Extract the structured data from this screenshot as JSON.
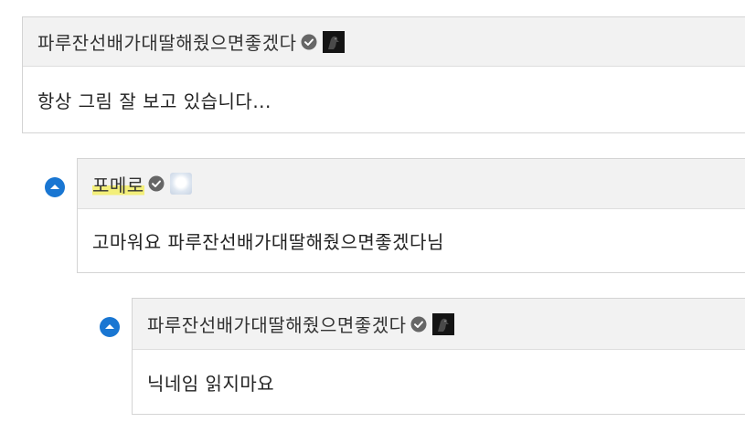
{
  "comments": [
    {
      "nickname": "파루잔선배가대딸해줬으면좋겠다",
      "avatar": "crow-avatar-icon",
      "verified": "check-circle-icon",
      "text": "항상 그림 잘 보고 있습니다..."
    },
    {
      "nickname": "포메로",
      "avatar": "character-avatar-icon",
      "verified": "check-circle-icon",
      "reply_icon": "reply-arrow-up-icon",
      "text": "고마워요 파루잔선배가대딸해줬으면좋겠다님"
    },
    {
      "nickname": "파루잔선배가대딸해줬으면좋겠다",
      "avatar": "crow-avatar-icon",
      "verified": "check-circle-icon",
      "reply_icon": "reply-arrow-up-icon",
      "text": "닉네임 읽지마요"
    }
  ],
  "colors": {
    "reply_icon": "#1976d2",
    "header_bg": "#f2f2f2",
    "border": "#d4d4d4",
    "highlight": "#f3ef7a"
  }
}
